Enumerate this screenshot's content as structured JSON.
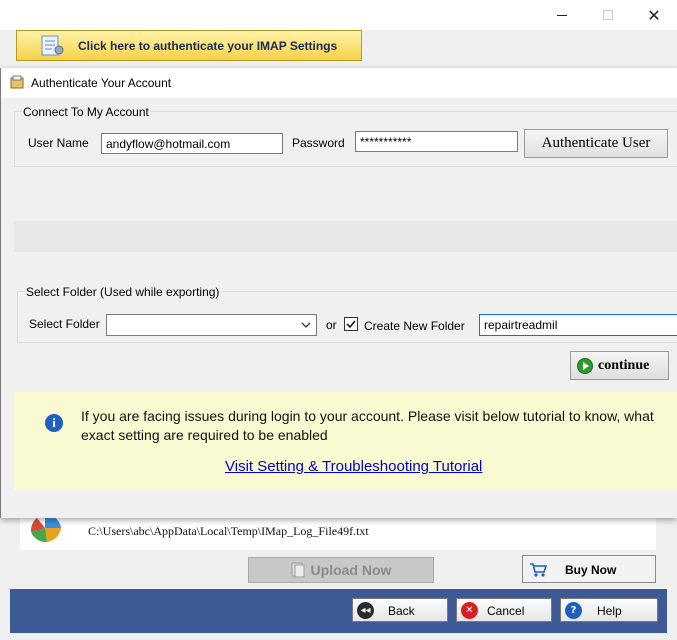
{
  "parent_window": {
    "controls": {
      "minimize": "",
      "maximize": "",
      "close": "✕"
    },
    "imap_button_label": "Click here to authenticate your IMAP Settings",
    "log_path": "C:\\Users\\abc\\AppData\\Local\\Temp\\IMap_Log_File49f.txt",
    "upload_label": "Upload Now",
    "buy_label": "Buy Now",
    "footer": {
      "back_label": "Back",
      "cancel_label": "Cancel",
      "help_label": "Help",
      "back_icon_glyph": "◂◂",
      "cancel_icon_glyph": "✕",
      "help_icon_glyph": "?"
    }
  },
  "dialog": {
    "title": "Authenticate Your Account",
    "account_group": {
      "legend": "Connect To My Account",
      "username_label": "User Name",
      "username_value": "andyflow@hotmail.com",
      "password_label": "Password",
      "password_value": "***********",
      "authenticate_label": "Authenticate User"
    },
    "folder_group": {
      "legend": "Select Folder (Used while exporting)",
      "select_label": "Select Folder",
      "select_value": "",
      "or_label": "or",
      "create_checked": true,
      "create_label": "Create New Folder",
      "new_folder_value": "repairtreadmil"
    },
    "continue_label": "continue",
    "info": {
      "icon_glyph": "i",
      "text": "If you are facing issues during login to your account. Please visit below tutorial to know, what exact setting are required to be enabled",
      "link_label": "Visit Setting & Troubleshooting Tutorial"
    }
  },
  "icons": [
    "settings-document-icon",
    "dialog-app-icon",
    "pie-chart-icon",
    "upload-icon",
    "cart-icon",
    "back-icon",
    "cancel-icon",
    "help-icon",
    "info-icon",
    "play-icon",
    "chevron-down-icon",
    "checkmark-icon"
  ],
  "colors": {
    "imap_button_gradient": [
      "#fff3a8",
      "#f6d24a"
    ],
    "footer_bar": "#3d5a96",
    "info_panel": "#fafad2",
    "link": "#0000cc",
    "focus_border": "#0078d7"
  }
}
